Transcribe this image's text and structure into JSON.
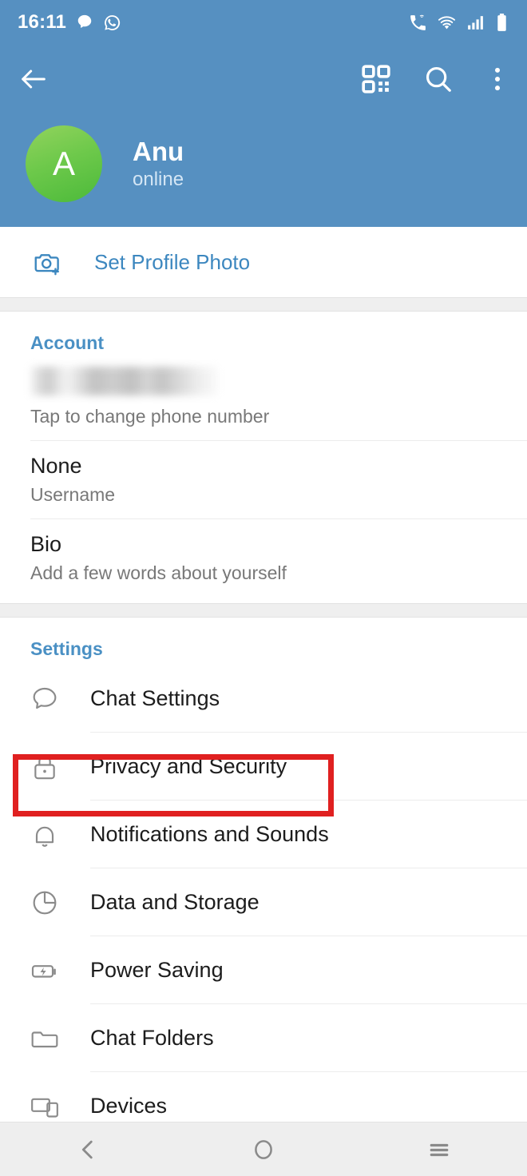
{
  "status_bar": {
    "time": "16:11",
    "left_icons": [
      "message-icon",
      "whatsapp-icon"
    ],
    "right_icons": [
      "call-wifi-icon",
      "wifi-icon",
      "signal-icon",
      "battery-icon"
    ]
  },
  "toolbar": {
    "back_icon": "back-arrow-icon",
    "actions": [
      {
        "icon": "qr-code-icon",
        "name": "qr-code-button"
      },
      {
        "icon": "search-icon",
        "name": "search-button"
      },
      {
        "icon": "overflow-menu-icon",
        "name": "overflow-menu-button"
      }
    ]
  },
  "profile": {
    "avatar_letter": "A",
    "name": "Anu",
    "status": "online"
  },
  "set_profile_photo": {
    "label": "Set Profile Photo",
    "icon": "camera-add-icon"
  },
  "account": {
    "title": "Account",
    "phone": {
      "value": "",
      "redacted": true,
      "subtitle": "Tap to change phone number"
    },
    "username": {
      "value": "None",
      "subtitle": "Username"
    },
    "bio": {
      "value": "Bio",
      "subtitle": "Add a few words about yourself"
    }
  },
  "settings": {
    "title": "Settings",
    "items": [
      {
        "label": "Chat Settings",
        "icon": "chat-bubble-icon"
      },
      {
        "label": "Privacy and Security",
        "icon": "lock-icon"
      },
      {
        "label": "Notifications and Sounds",
        "icon": "bell-icon"
      },
      {
        "label": "Data and Storage",
        "icon": "pie-chart-icon"
      },
      {
        "label": "Power Saving",
        "icon": "battery-bolt-icon"
      },
      {
        "label": "Chat Folders",
        "icon": "folder-icon"
      },
      {
        "label": "Devices",
        "icon": "devices-icon"
      }
    ],
    "highlighted_item": "Privacy and Security"
  },
  "nav_bar": {
    "buttons": [
      {
        "name": "nav-back-button",
        "icon": "chevron-left-icon"
      },
      {
        "name": "nav-home-button",
        "icon": "circle-icon"
      },
      {
        "name": "nav-recents-button",
        "icon": "hamburger-icon"
      }
    ]
  },
  "colors": {
    "header_blue": "#5690C1",
    "accent_blue": "#3C87BF",
    "highlight_red": "#E02020",
    "avatar_green": "#6EC94B",
    "band_gray": "#EFEFEF"
  }
}
